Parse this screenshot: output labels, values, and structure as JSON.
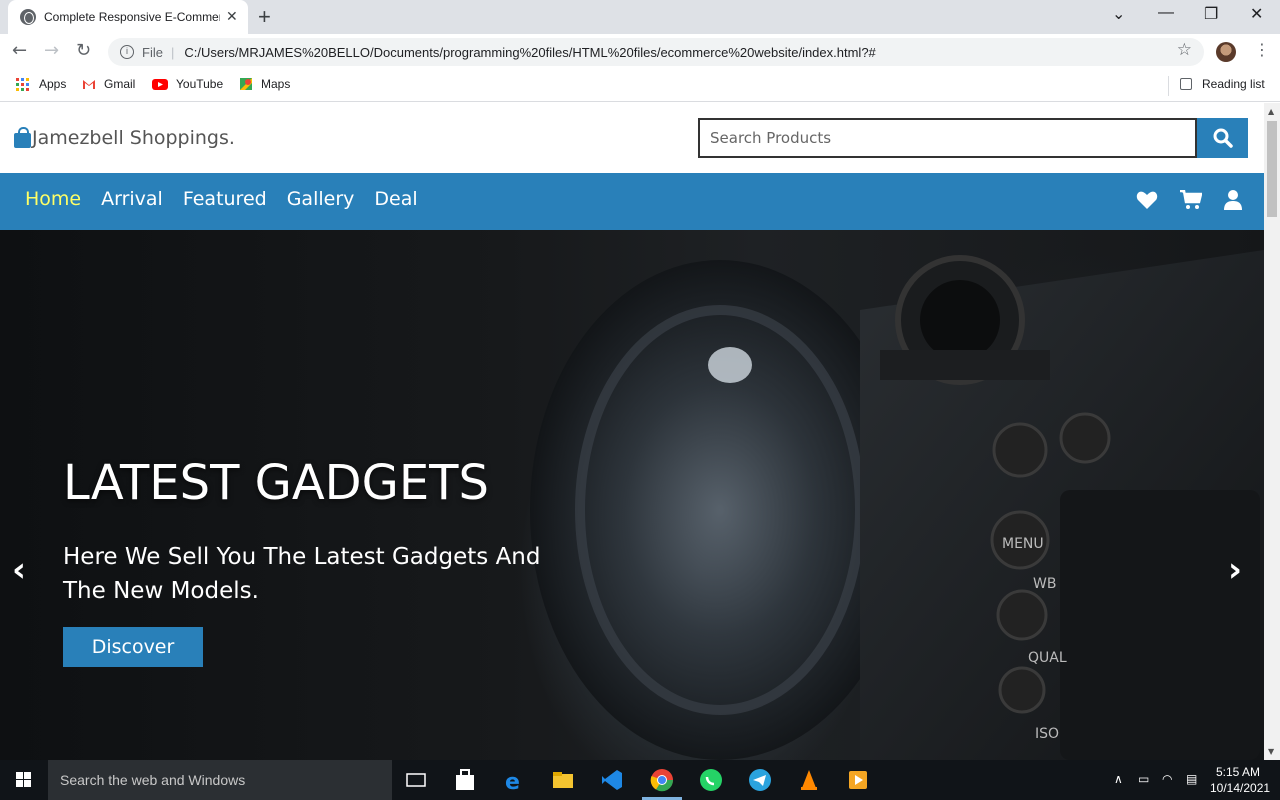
{
  "browser": {
    "tab_title": "Complete Responsive E-Commerce",
    "tab_close": "✕",
    "new_tab": "+",
    "url_prefix": "File",
    "url": "C:/Users/MRJAMES%20BELLO/Documents/programming%20files/HTML%20files/ecommerce%20website/index.html?#",
    "bookmarks": [
      {
        "label": "Apps"
      },
      {
        "label": "Gmail"
      },
      {
        "label": "YouTube"
      },
      {
        "label": "Maps"
      }
    ],
    "reading_list": "Reading list"
  },
  "site": {
    "logo_text": "Jamezbell Shoppings.",
    "search_placeholder": "Search Products",
    "nav": [
      {
        "label": "Home",
        "active": true
      },
      {
        "label": "Arrival",
        "active": false
      },
      {
        "label": "Featured",
        "active": false
      },
      {
        "label": "Gallery",
        "active": false
      },
      {
        "label": "Deal",
        "active": false
      }
    ],
    "nav_icons": [
      "heart-icon",
      "cart-icon",
      "user-icon"
    ],
    "accent_color": "#2980b9",
    "active_nav_color": "#ffff66"
  },
  "hero": {
    "title": "LATEST GADGETS",
    "subtitle": "Here We Sell You The Latest Gadgets And The New Models.",
    "cta": "Discover",
    "prev": "‹",
    "next": "›",
    "camera_labels": [
      "MENU",
      "WB",
      "QUAL",
      "ISO"
    ]
  },
  "taskbar": {
    "search_placeholder": "Search the web and Windows",
    "time": "5:15 AM",
    "date": "10/14/2021"
  }
}
